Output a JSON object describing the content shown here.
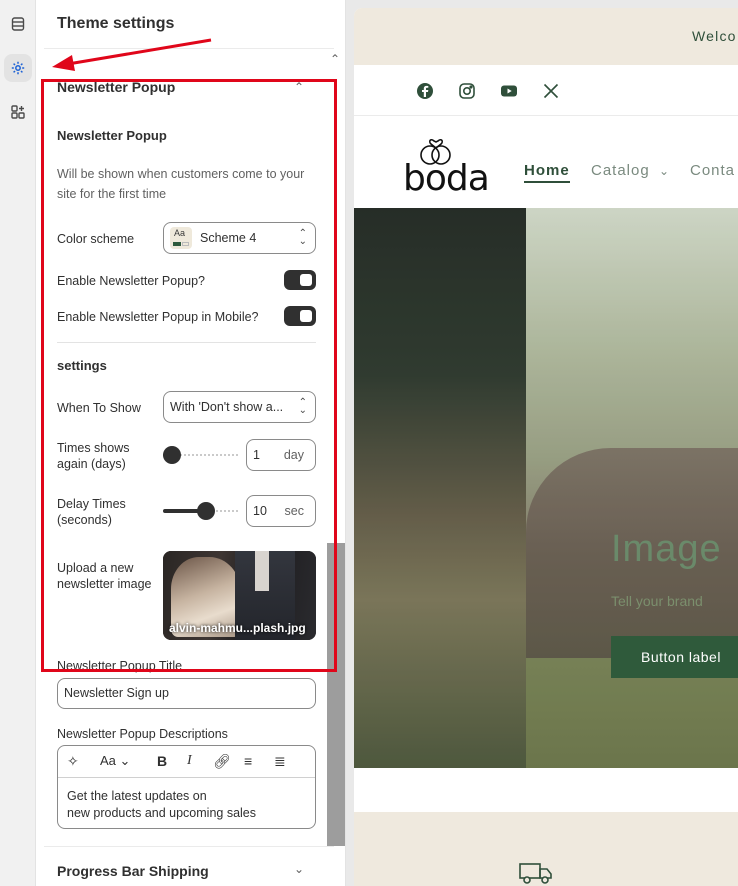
{
  "panel": {
    "title": "Theme settings",
    "section_title": "Newsletter Popup",
    "subheading": "Newsletter Popup",
    "description": "Will be shown when customers come to your site for the first time",
    "color_scheme": {
      "label": "Color scheme",
      "value": "Scheme 4",
      "swatch_text": "Aa"
    },
    "enable_popup": {
      "label": "Enable Newsletter Popup?",
      "on": true
    },
    "enable_mobile": {
      "label": "Enable Newsletter Popup in Mobile?",
      "on": true
    },
    "settings_heading": "settings",
    "when_to_show": {
      "label": "When To Show",
      "value": "With 'Don't show a..."
    },
    "times_shows_again": {
      "label": "Times shows again (days)",
      "value": "1",
      "unit": "day",
      "slider_fraction": 0.0
    },
    "delay_times": {
      "label": "Delay Times (seconds)",
      "value": "10",
      "unit": "sec",
      "slider_fraction": 0.6
    },
    "upload_image": {
      "label": "Upload a new newsletter image",
      "filename": "alvin-mahmu...plash.jpg"
    },
    "popup_title": {
      "label": "Newsletter Popup Title",
      "value": "Newsletter Sign up"
    },
    "popup_descriptions": {
      "label": "Newsletter Popup Descriptions",
      "value": "Get the latest updates on\n new products and upcoming sales"
    },
    "next_section": "Progress Bar Shipping"
  },
  "rte_tools": [
    "magic-icon",
    "font-size-icon",
    "bold-icon",
    "italic-icon",
    "link-icon",
    "bullet-list-icon",
    "numbered-list-icon"
  ],
  "preview": {
    "announcement": "Welco",
    "logo": "boda",
    "nav": [
      "Home",
      "Catalog",
      "Conta"
    ],
    "hero_title": "Image",
    "hero_subtitle": "Tell your brand",
    "hero_button": "Button label"
  },
  "colors": {
    "accent_red": "#e0061a",
    "brand_green": "#2f5a3b",
    "beige": "#efe9de"
  }
}
